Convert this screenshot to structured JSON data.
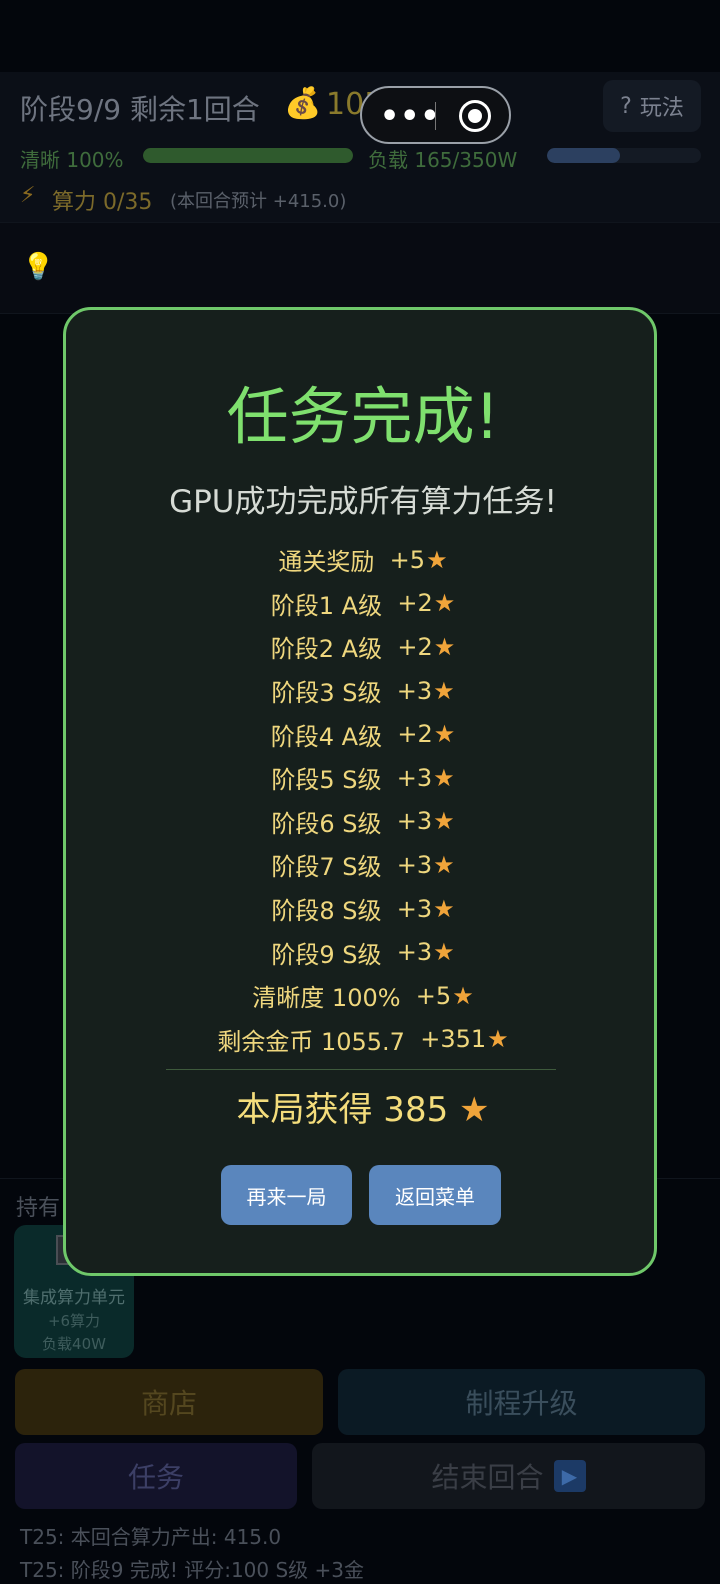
{
  "header": {
    "stage_title": "阶段9/9  剩余1回合",
    "money_icon": "money-bag-icon",
    "money_value": "1055.7",
    "help_label": "玩法",
    "help_icon": "?",
    "clarity_label": "清晰 100%",
    "clarity_progress": 1.0,
    "load_label": "负载 165/350W",
    "load_progress": 0.4714,
    "compute_label": "算力 0/35",
    "compute_estimate": "(本回合预计 +415.0)"
  },
  "tip": {
    "icon": "lightbulb-icon"
  },
  "modal": {
    "title": "任务完成!",
    "subtitle": "GPU成功完成所有算力任务!",
    "rewards": [
      {
        "label": "通关奖励  ",
        "value": "+5"
      },
      {
        "label": "阶段1 A级  ",
        "value": "+2"
      },
      {
        "label": "阶段2 A级  ",
        "value": "+2"
      },
      {
        "label": "阶段3 S级  ",
        "value": "+3"
      },
      {
        "label": "阶段4 A级  ",
        "value": "+2"
      },
      {
        "label": "阶段5 S级  ",
        "value": "+3"
      },
      {
        "label": "阶段6 S级  ",
        "value": "+3"
      },
      {
        "label": "阶段7 S级  ",
        "value": "+3"
      },
      {
        "label": "阶段8 S级  ",
        "value": "+3"
      },
      {
        "label": "阶段9 S级  ",
        "value": "+3"
      },
      {
        "label": "清晰度 100%  ",
        "value": "+5"
      },
      {
        "label": "剩余金币 1055.7  ",
        "value": "+351"
      }
    ],
    "total": "本局获得 385 ",
    "retry_label": "再来一局",
    "menu_label": "返回菜单"
  },
  "bottom": {
    "hold_label": "持有",
    "card": {
      "name": "集成算力单元",
      "power": "+6算力",
      "load": "负载40W"
    },
    "shop_label": "商店",
    "upgrade_label": "制程升级",
    "task_label": "任务",
    "end_label": "结束回合",
    "log": [
      "T25: 本回合算力产出: 415.0",
      "T25: 阶段9 完成! 评分:100 S级 +3金"
    ]
  },
  "colors": {
    "modal_border": "#6fc86a",
    "title_green": "#7fe06e",
    "reward_text": "#efd77e",
    "star": "#f0a43a",
    "button_blue": "#5a86bd"
  }
}
